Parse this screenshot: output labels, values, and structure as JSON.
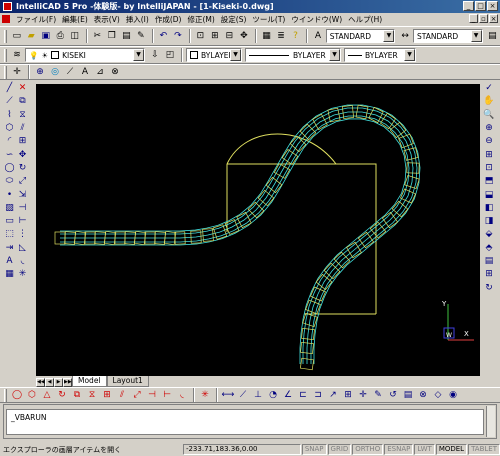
{
  "window": {
    "title": "IntelliCAD 5 Pro -体験版- by IntelliJAPAN - [1-Kiseki-0.dwg]"
  },
  "menu": [
    "ファイル(F)",
    "編集(E)",
    "表示(V)",
    "挿入(I)",
    "作成(D)",
    "修正(M)",
    "設定(S)",
    "ツール(T)",
    "ウインドウ(W)",
    "ヘルプ(H)"
  ],
  "toolbar_standard": {
    "text_style": "STANDARD",
    "dim_style": "STANDARD"
  },
  "toolbar_properties": {
    "layer": "KISEKI",
    "color": "BYLAYER",
    "linetype": "BYLAYER",
    "lineweight": "BYLAYER"
  },
  "tabs": {
    "model": "Model",
    "layout1": "Layout1"
  },
  "command_line": {
    "text": "_VBARUN"
  },
  "status_bar": {
    "message": "エクスプローラの画層アイテムを開く",
    "coordinates": "-233.71,183.36,0.00",
    "toggles": [
      {
        "label": "SNAP",
        "on": false
      },
      {
        "label": "GRID",
        "on": false
      },
      {
        "label": "ORTHO",
        "on": false
      },
      {
        "label": "ESNAP",
        "on": false
      },
      {
        "label": "LWT",
        "on": false
      },
      {
        "label": "MODEL",
        "on": true
      },
      {
        "label": "TABLET",
        "on": false
      }
    ]
  },
  "ucs_icon": {
    "x_label": "X",
    "y_label": "Y",
    "w_label": "W"
  },
  "colors": {
    "canvas_bg": "#000000",
    "track_cyan": "#40e0e0",
    "box_yellow": "#e0e060",
    "frame_yellow": "#e0e060",
    "ucs_green": "#40c040",
    "ucs_red": "#e04040",
    "ucs_blue": "#4040e0"
  }
}
